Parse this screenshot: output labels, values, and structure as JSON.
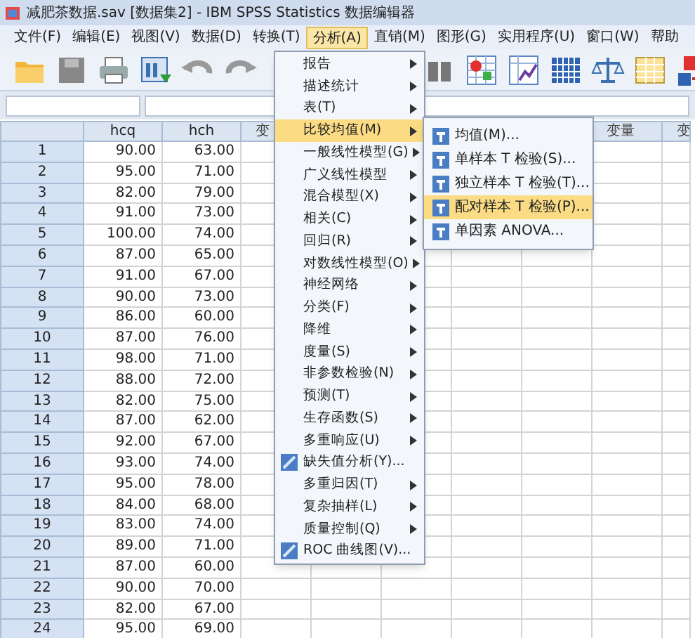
{
  "window": {
    "title": "减肥茶数据.sav [数据集2] - IBM SPSS Statistics 数据编辑器"
  },
  "menubar": [
    {
      "label": "文件(F)",
      "selected": false
    },
    {
      "label": "编辑(E)",
      "selected": false
    },
    {
      "label": "视图(V)",
      "selected": false
    },
    {
      "label": "数据(D)",
      "selected": false
    },
    {
      "label": "转换(T)",
      "selected": false
    },
    {
      "label": "分析(A)",
      "selected": true
    },
    {
      "label": "直销(M)",
      "selected": false
    },
    {
      "label": "图形(G)",
      "selected": false
    },
    {
      "label": "实用程序(U)",
      "selected": false
    },
    {
      "label": "窗口(W)",
      "selected": false
    },
    {
      "label": "帮助",
      "selected": false
    }
  ],
  "table": {
    "columns": [
      {
        "kind": "data",
        "label": "hcq"
      },
      {
        "kind": "data",
        "label": "hch"
      },
      {
        "kind": "var",
        "label": "变"
      },
      {
        "kind": "var"
      },
      {
        "kind": "var"
      },
      {
        "kind": "var"
      },
      {
        "kind": "var"
      },
      {
        "kind": "var",
        "label": "变量"
      },
      {
        "kind": "var",
        "label": "变"
      }
    ],
    "rows": [
      {
        "number": "1",
        "cells": [
          "90.00",
          "63.00"
        ]
      },
      {
        "number": "2",
        "cells": [
          "95.00",
          "71.00"
        ]
      },
      {
        "number": "3",
        "cells": [
          "82.00",
          "79.00"
        ]
      },
      {
        "number": "4",
        "cells": [
          "91.00",
          "73.00"
        ]
      },
      {
        "number": "5",
        "cells": [
          "100.00",
          "74.00"
        ]
      },
      {
        "number": "6",
        "cells": [
          "87.00",
          "65.00"
        ]
      },
      {
        "number": "7",
        "cells": [
          "91.00",
          "67.00"
        ]
      },
      {
        "number": "8",
        "cells": [
          "90.00",
          "73.00"
        ]
      },
      {
        "number": "9",
        "cells": [
          "86.00",
          "60.00"
        ]
      },
      {
        "number": "10",
        "cells": [
          "87.00",
          "76.00"
        ]
      },
      {
        "number": "11",
        "cells": [
          "98.00",
          "71.00"
        ]
      },
      {
        "number": "12",
        "cells": [
          "88.00",
          "72.00"
        ]
      },
      {
        "number": "13",
        "cells": [
          "82.00",
          "75.00"
        ]
      },
      {
        "number": "14",
        "cells": [
          "87.00",
          "62.00"
        ]
      },
      {
        "number": "15",
        "cells": [
          "92.00",
          "67.00"
        ]
      },
      {
        "number": "16",
        "cells": [
          "93.00",
          "74.00"
        ]
      },
      {
        "number": "17",
        "cells": [
          "95.00",
          "78.00"
        ]
      },
      {
        "number": "18",
        "cells": [
          "84.00",
          "68.00"
        ]
      },
      {
        "number": "19",
        "cells": [
          "83.00",
          "74.00"
        ]
      },
      {
        "number": "20",
        "cells": [
          "89.00",
          "71.00"
        ]
      },
      {
        "number": "21",
        "cells": [
          "87.00",
          "60.00"
        ]
      },
      {
        "number": "22",
        "cells": [
          "90.00",
          "70.00"
        ]
      },
      {
        "number": "23",
        "cells": [
          "82.00",
          "67.00"
        ]
      },
      {
        "number": "24",
        "cells": [
          "95.00",
          "69.00"
        ]
      }
    ]
  },
  "analyze_menu": {
    "items": [
      {
        "label": "报告",
        "kind": "submenu",
        "selected": false
      },
      {
        "label": "描述统计",
        "kind": "submenu",
        "selected": false
      },
      {
        "label": "表(T)",
        "kind": "submenu",
        "selected": false
      },
      {
        "label": "比较均值(M)",
        "kind": "submenu",
        "selected": true
      },
      {
        "label": "一般线性模型(G)",
        "kind": "submenu",
        "selected": false
      },
      {
        "label": "广义线性模型",
        "kind": "submenu",
        "selected": false
      },
      {
        "label": "混合模型(X)",
        "kind": "submenu",
        "selected": false
      },
      {
        "label": "相关(C)",
        "kind": "submenu",
        "selected": false
      },
      {
        "label": "回归(R)",
        "kind": "submenu",
        "selected": false
      },
      {
        "label": "对数线性模型(O)",
        "kind": "submenu",
        "selected": false
      },
      {
        "label": "神经网络",
        "kind": "submenu",
        "selected": false
      },
      {
        "label": "分类(F)",
        "kind": "submenu",
        "selected": false
      },
      {
        "label": "降维",
        "kind": "submenu",
        "selected": false
      },
      {
        "label": "度量(S)",
        "kind": "submenu",
        "selected": false
      },
      {
        "label": "非参数检验(N)",
        "kind": "submenu",
        "selected": false
      },
      {
        "label": "预测(T)",
        "kind": "submenu",
        "selected": false
      },
      {
        "label": "生存函数(S)",
        "kind": "submenu",
        "selected": false
      },
      {
        "label": "多重响应(U)",
        "kind": "submenu",
        "selected": false
      },
      {
        "label": "缺失值分析(Y)...",
        "kind": "dialog",
        "selected": false
      },
      {
        "label": "多重归因(T)",
        "kind": "submenu",
        "selected": false
      },
      {
        "label": "复杂抽样(L)",
        "kind": "submenu",
        "selected": false
      },
      {
        "label": "质量控制(Q)",
        "kind": "submenu",
        "selected": false
      },
      {
        "label": "ROC 曲线图(V)...",
        "kind": "dialog",
        "selected": false
      }
    ]
  },
  "compare_means_menu": {
    "items": [
      {
        "label": "均值(M)...",
        "selected": false
      },
      {
        "label": "单样本 T 检验(S)...",
        "selected": false
      },
      {
        "label": "独立样本 T 检验(T)...",
        "selected": false
      },
      {
        "label": "配对样本 T 检验(P)...",
        "selected": true
      },
      {
        "label": "单因素 ANOVA...",
        "selected": false
      }
    ]
  }
}
